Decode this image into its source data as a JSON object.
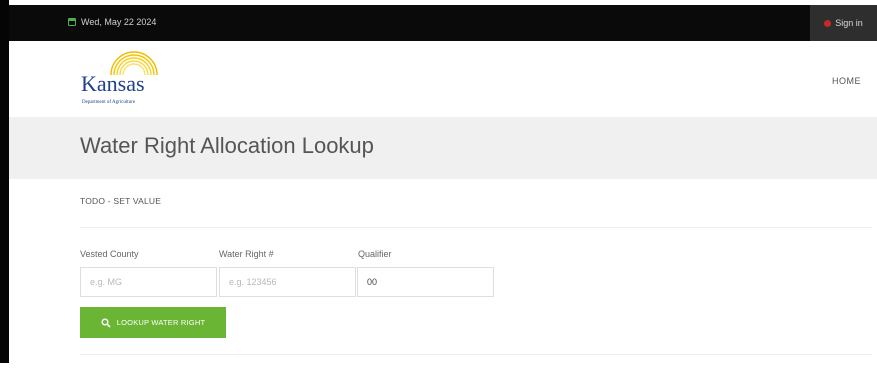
{
  "topbar": {
    "date": "Wed, May 22 2024",
    "signin_label": "Sign in"
  },
  "header": {
    "logo_text": "Kansas",
    "logo_subtext": "Department of Agriculture",
    "nav_home": "HOME"
  },
  "page": {
    "title": "Water Right Allocation Lookup",
    "todo_text": "TODO - SET VALUE"
  },
  "form": {
    "fields": [
      {
        "label": "Vested County",
        "placeholder": "e.g. MG",
        "value": ""
      },
      {
        "label": "Water Right #",
        "placeholder": "e.g. 123456",
        "value": ""
      },
      {
        "label": "Qualifier",
        "placeholder": "",
        "value": "00"
      }
    ],
    "submit_label": "LOOKUP WATER RIGHT"
  },
  "colors": {
    "topbar": "#0a0a0a",
    "accent_green": "#6bb535",
    "title_band": "#f0f0f0",
    "logo_blue": "#1f3f8f",
    "logo_gold": "#f2b800"
  },
  "icons": {
    "date": "calendar-icon",
    "signin": "power-icon",
    "submit": "search-icon"
  }
}
